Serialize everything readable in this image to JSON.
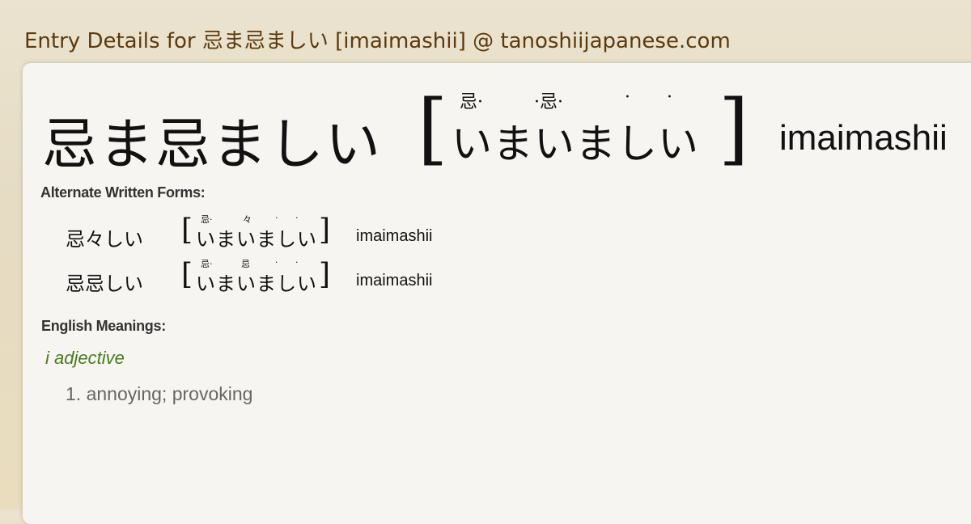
{
  "header": {
    "title": "Entry Details for 忌ま忌ましい [imaimashii] @ tanoshiijapanese.com"
  },
  "entry": {
    "term": "忌ま忌ましい",
    "bracket_open": "[",
    "bracket_close": "]",
    "reading_kana": "いまいましい",
    "furigana": [
      "忌·",
      "·忌·",
      "·",
      "·"
    ],
    "romaji": "imaimashii"
  },
  "alternate_forms": {
    "label": "Alternate Written Forms:",
    "items": [
      {
        "term": "忌々しい",
        "kana": "いまいましい",
        "furigana": [
          "忌·",
          "々",
          "·",
          "·"
        ],
        "romaji": "imaimashii"
      },
      {
        "term": "忌忌しい",
        "kana": "いまいましい",
        "furigana": [
          "忌·",
          "忌",
          "·",
          "·"
        ],
        "romaji": "imaimashii"
      }
    ]
  },
  "meanings": {
    "label": "English Meanings:",
    "part_of_speech": "i adjective",
    "items": [
      "1. annoying; provoking"
    ]
  }
}
